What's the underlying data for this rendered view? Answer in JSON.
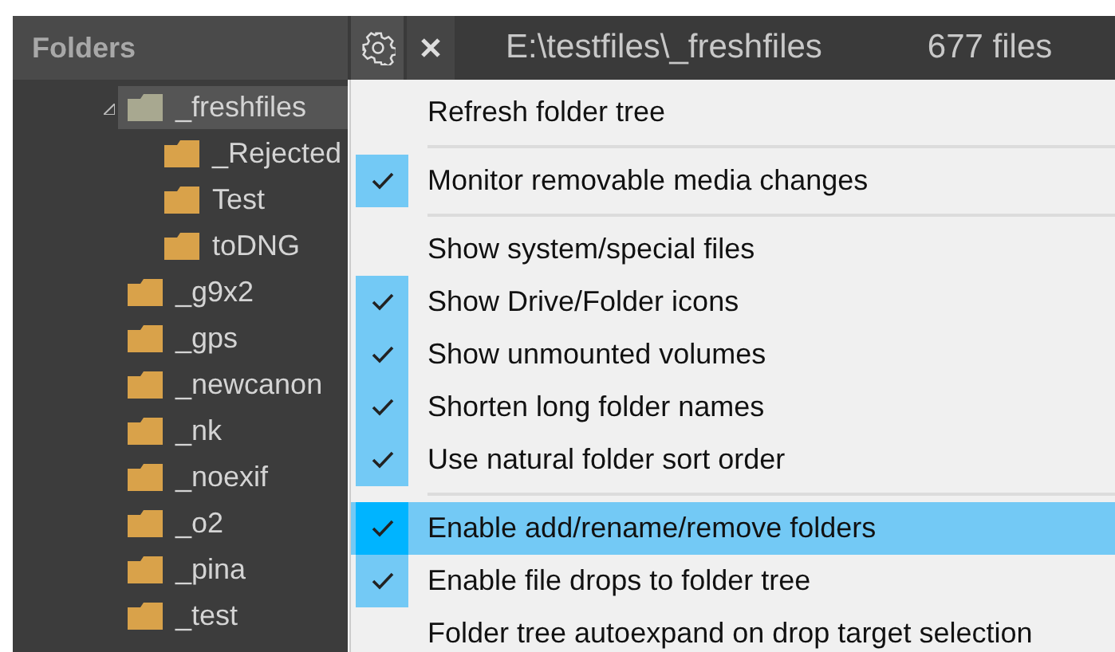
{
  "panel": {
    "title": "Folders",
    "path": "E:\\testfiles\\_freshfiles",
    "file_count": "677 files"
  },
  "tree": [
    {
      "label": "_freshfiles",
      "selected": true,
      "expanded": true,
      "children": [
        {
          "label": "_Rejected",
          "selected": false
        },
        {
          "label": "Test",
          "selected": false
        },
        {
          "label": "toDNG",
          "selected": false
        }
      ]
    },
    {
      "label": "_g9x2",
      "selected": false
    },
    {
      "label": "_gps",
      "selected": false
    },
    {
      "label": "_newcanon",
      "selected": false
    },
    {
      "label": "_nk",
      "selected": false
    },
    {
      "label": "_noexif",
      "selected": false
    },
    {
      "label": "_o2",
      "selected": false
    },
    {
      "label": "_pina",
      "selected": false
    },
    {
      "label": "_test",
      "selected": false
    }
  ],
  "menu": [
    {
      "kind": "item",
      "label": "Refresh folder tree",
      "checked": false,
      "selected": false
    },
    {
      "kind": "separator"
    },
    {
      "kind": "item",
      "label": "Monitor removable media changes",
      "checked": true,
      "selected": false
    },
    {
      "kind": "separator"
    },
    {
      "kind": "item",
      "label": "Show system/special files",
      "checked": false,
      "selected": false
    },
    {
      "kind": "item",
      "label": "Show Drive/Folder icons",
      "checked": true,
      "selected": false
    },
    {
      "kind": "item",
      "label": "Show unmounted volumes",
      "checked": true,
      "selected": false
    },
    {
      "kind": "item",
      "label": "Shorten long folder names",
      "checked": true,
      "selected": false
    },
    {
      "kind": "item",
      "label": "Use natural folder sort order",
      "checked": true,
      "selected": false
    },
    {
      "kind": "separator"
    },
    {
      "kind": "item",
      "label": "Enable add/rename/remove folders",
      "checked": true,
      "selected": true
    },
    {
      "kind": "item",
      "label": "Enable file drops to folder tree",
      "checked": true,
      "selected": false
    },
    {
      "kind": "item",
      "label": "Folder tree autoexpand on drop target selection",
      "checked": false,
      "selected": false
    }
  ]
}
